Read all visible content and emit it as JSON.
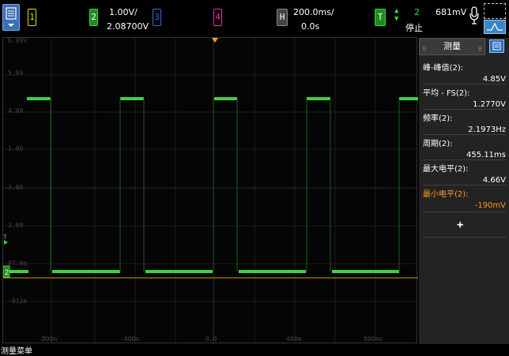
{
  "channels": {
    "ch1_label": "1",
    "ch2_label": "2",
    "ch3_label": "3",
    "ch4_label": "4",
    "ch2_scale": "1.00V/",
    "ch2_offset": "2.08700V"
  },
  "horizontal": {
    "label": "H",
    "scale": "200.0ms/",
    "delay": "0.0s"
  },
  "trigger": {
    "label": "T",
    "source": "2",
    "level": "681mV",
    "state": "停止"
  },
  "graticule": {
    "y_labels": [
      "6.09V",
      "5.09",
      "4.09",
      "3.09",
      "2.09",
      "1.09",
      "87.0m",
      "-912m"
    ],
    "x_labels": [
      "-800m",
      "-400m",
      "0.0",
      "400m",
      "800ms"
    ],
    "marker_label": "T"
  },
  "panel": {
    "title": "测量",
    "add_label": "+"
  },
  "measurements": [
    {
      "name": "峰-峰值(2):",
      "value": "4.85V"
    },
    {
      "name": "平均 - FS(2):",
      "value": "1.2770V"
    },
    {
      "name": "频率(2):",
      "value": "2.1973Hz"
    },
    {
      "name": "周期(2):",
      "value": "455.11ms"
    },
    {
      "name": "最大电平(2):",
      "value": "4.66V"
    },
    {
      "name": "最小电平(2):",
      "value": "-190mV"
    }
  ],
  "bottom_label": "测量菜单",
  "colors": {
    "ch1": "#e8e000",
    "ch2": "#3fd23f",
    "ch3": "#3a6ad8",
    "ch4": "#e0389a",
    "selected_measurement": "#ff9a1f",
    "trigger_level_line": "#c8a000"
  }
}
